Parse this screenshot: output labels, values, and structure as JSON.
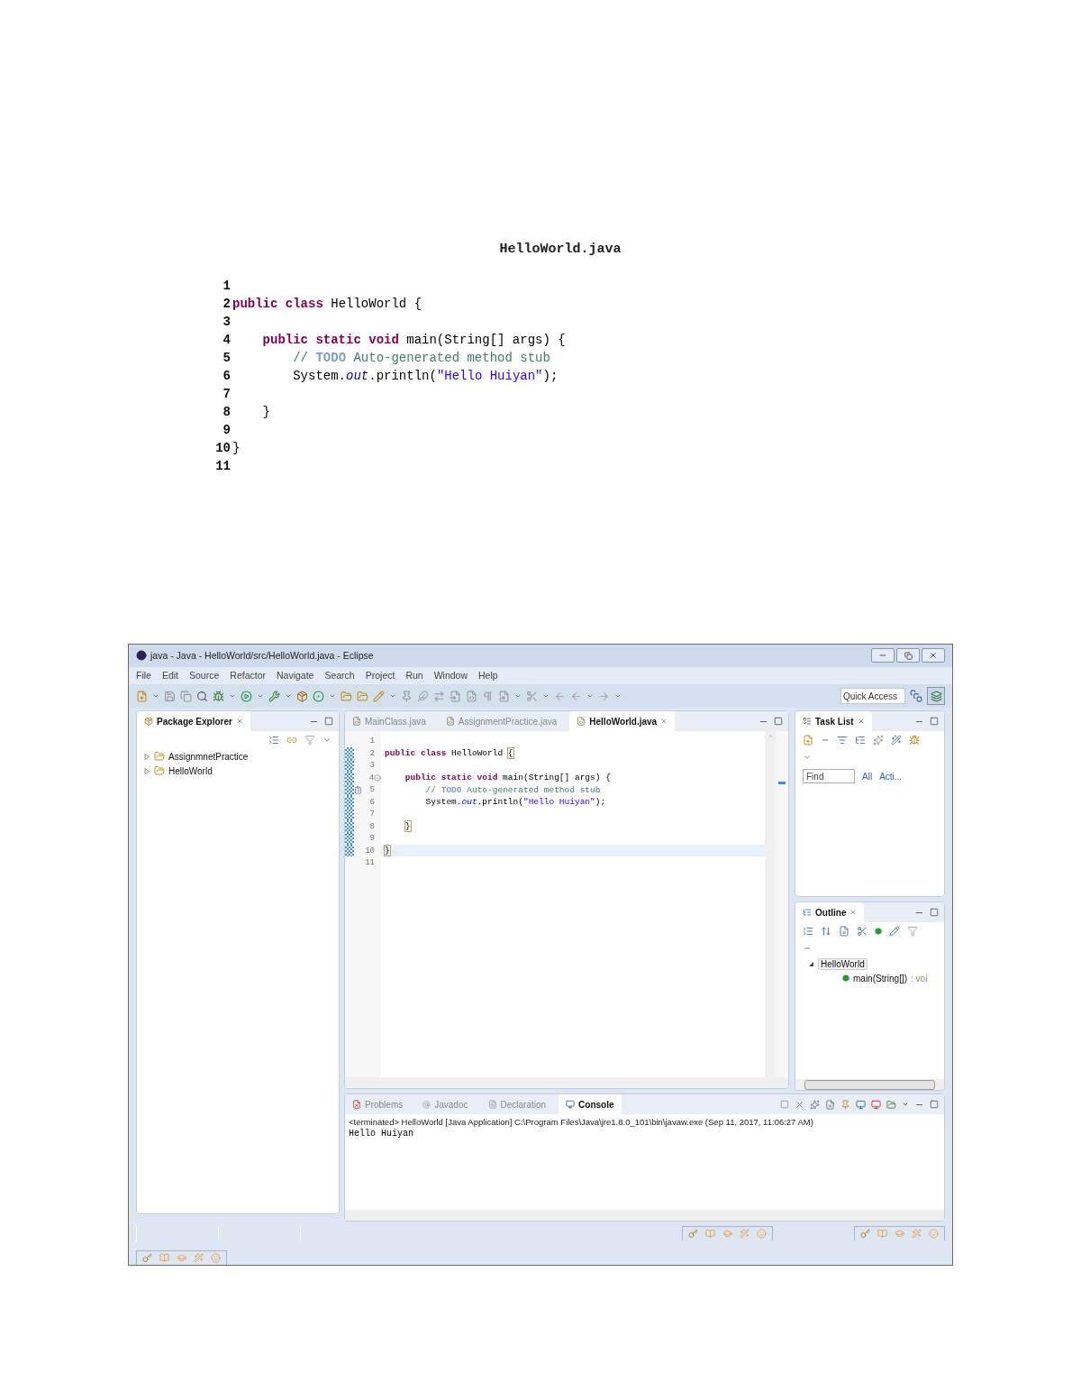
{
  "document": {
    "title": "HelloWorld.java",
    "lines": [
      {
        "number": "1"
      },
      {
        "number": "2",
        "tokens": [
          {
            "kind": "keyword",
            "text": "public class"
          },
          {
            "kind": "plain",
            "text": " HelloWorld {"
          }
        ]
      },
      {
        "number": "3"
      },
      {
        "number": "4",
        "tokens": [
          {
            "kind": "keyword",
            "text": "    public static void"
          },
          {
            "kind": "plain",
            "text": " main(String[] args) {"
          }
        ]
      },
      {
        "number": "5",
        "tokens": [
          {
            "kind": "comment",
            "text": "        // "
          },
          {
            "kind": "task",
            "text": "TODO"
          },
          {
            "kind": "comment",
            "text": " Auto-generated method stub"
          }
        ]
      },
      {
        "number": "6",
        "tokens": [
          {
            "kind": "plain",
            "text": "        System."
          },
          {
            "kind": "field",
            "text": "out"
          },
          {
            "kind": "plain",
            "text": ".println("
          },
          {
            "kind": "string",
            "text": "\"Hello Huiyan\""
          },
          {
            "kind": "plain",
            "text": ");"
          }
        ]
      },
      {
        "number": "7"
      },
      {
        "number": "8",
        "tokens": [
          {
            "kind": "plain",
            "text": "    }"
          }
        ]
      },
      {
        "number": "9"
      },
      {
        "number": "10",
        "tokens": [
          {
            "kind": "plain",
            "text": "}"
          }
        ]
      },
      {
        "number": "11"
      }
    ]
  },
  "eclipse": {
    "window": {
      "title": "java - Java - HelloWorld/src/HelloWorld.java - Eclipse"
    },
    "menu": [
      "File",
      "Edit",
      "Source",
      "Refactor",
      "Navigate",
      "Search",
      "Project",
      "Run",
      "Window",
      "Help"
    ],
    "quick_access": {
      "placeholder": "Quick Access"
    },
    "package_explorer": {
      "tab": "Package Explorer",
      "items": [
        {
          "label": "AssignmnetPractice",
          "expanded": false
        },
        {
          "label": "HelloWorld",
          "expanded": false
        }
      ]
    },
    "editor": {
      "tabs": [
        {
          "label": "MainClass.java",
          "selected": false
        },
        {
          "label": "AssignmentPractice.java",
          "selected": false
        },
        {
          "label": "HelloWorld.java",
          "selected": true
        }
      ],
      "lines": [
        {
          "number": "1",
          "fold": false,
          "task": false,
          "current": false
        },
        {
          "number": "2",
          "fold": false,
          "task": false,
          "current": false,
          "tokens": [
            {
              "kind": "keyword",
              "text": "public class"
            },
            {
              "kind": "plain",
              "text": " HelloWorld "
            },
            {
              "kind": "bracket",
              "text": "{"
            }
          ]
        },
        {
          "number": "3",
          "fold": false,
          "task": false,
          "current": false
        },
        {
          "number": "4",
          "fold": true,
          "task": false,
          "current": false,
          "tokens": [
            {
              "kind": "keyword",
              "text": "    public static void"
            },
            {
              "kind": "plain",
              "text": " main(String[] args) {"
            }
          ]
        },
        {
          "number": "5",
          "fold": false,
          "task": true,
          "current": false,
          "tokens": [
            {
              "kind": "comment",
              "text": "        // "
            },
            {
              "kind": "task",
              "text": "TODO"
            },
            {
              "kind": "comment",
              "text": " Auto-generated method stub"
            }
          ]
        },
        {
          "number": "6",
          "fold": false,
          "task": false,
          "current": false,
          "tokens": [
            {
              "kind": "plain",
              "text": "        System."
            },
            {
              "kind": "field",
              "text": "out"
            },
            {
              "kind": "plain",
              "text": ".println("
            },
            {
              "kind": "string",
              "text": "\"Hello Huiyan\""
            },
            {
              "kind": "plain",
              "text": ");"
            }
          ]
        },
        {
          "number": "7",
          "fold": false,
          "task": false,
          "current": false
        },
        {
          "number": "8",
          "fold": false,
          "task": false,
          "current": false,
          "tokens": [
            {
              "kind": "bracket",
              "text": "    }"
            }
          ]
        },
        {
          "number": "9",
          "fold": false,
          "task": false,
          "current": false
        },
        {
          "number": "10",
          "fold": false,
          "task": false,
          "current": true,
          "tokens": [
            {
              "kind": "bracket",
              "text": "}"
            }
          ]
        },
        {
          "number": "11",
          "fold": false,
          "task": false,
          "current": false
        }
      ]
    },
    "task_list": {
      "tab": "Task List",
      "find": {
        "placeholder": "Find"
      },
      "filters": [
        "All",
        "Acti..."
      ]
    },
    "outline": {
      "tab": "Outline",
      "items": [
        {
          "label": "HelloWorld",
          "expanded": true,
          "children": [
            {
              "label": "main(String[])",
              "type": " : voi"
            }
          ]
        }
      ]
    },
    "console": {
      "tabs": [
        {
          "label": "Problems",
          "selected": false
        },
        {
          "label": "Javadoc",
          "selected": false
        },
        {
          "label": "Declaration",
          "selected": false
        },
        {
          "label": "Console",
          "selected": true
        }
      ],
      "lines": [
        {
          "kind": "status",
          "text": "<terminated> HelloWorld [Java Application] C:\\Program Files\\Java\\jre1.8.0_101\\bin\\javaw.exe (Sep 11, 2017, 11:06:27 AM)"
        },
        {
          "kind": "output",
          "text": "Hello Huiyan"
        }
      ]
    }
  }
}
